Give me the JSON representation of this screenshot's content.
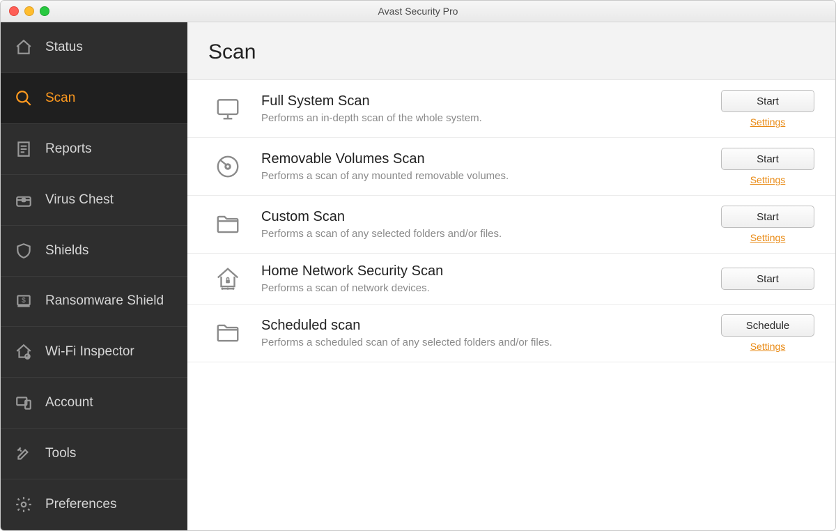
{
  "window_title": "Avast Security Pro",
  "sidebar": {
    "items": [
      {
        "id": "status",
        "label": "Status",
        "active": false
      },
      {
        "id": "scan",
        "label": "Scan",
        "active": true
      },
      {
        "id": "reports",
        "label": "Reports",
        "active": false
      },
      {
        "id": "virus-chest",
        "label": "Virus Chest",
        "active": false
      },
      {
        "id": "shields",
        "label": "Shields",
        "active": false
      },
      {
        "id": "ransomware-shield",
        "label": "Ransomware Shield",
        "active": false
      },
      {
        "id": "wifi-inspector",
        "label": "Wi-Fi Inspector",
        "active": false
      },
      {
        "id": "account",
        "label": "Account",
        "active": false
      },
      {
        "id": "tools",
        "label": "Tools",
        "active": false
      },
      {
        "id": "preferences",
        "label": "Preferences",
        "active": false
      }
    ]
  },
  "page": {
    "title": "Scan",
    "scans": [
      {
        "id": "full-system",
        "title": "Full System Scan",
        "desc": "Performs an in-depth scan of the whole system.",
        "button": "Start",
        "settings_label": "Settings",
        "show_settings": true
      },
      {
        "id": "removable",
        "title": "Removable Volumes Scan",
        "desc": "Performs a scan of any mounted removable volumes.",
        "button": "Start",
        "settings_label": "Settings",
        "show_settings": true
      },
      {
        "id": "custom",
        "title": "Custom Scan",
        "desc": "Performs a scan of any selected folders and/or files.",
        "button": "Start",
        "settings_label": "Settings",
        "show_settings": true
      },
      {
        "id": "network",
        "title": "Home Network Security Scan",
        "desc": "Performs a scan of network devices.",
        "button": "Start",
        "settings_label": "Settings",
        "show_settings": false
      },
      {
        "id": "scheduled",
        "title": "Scheduled scan",
        "desc": "Performs a scheduled scan of any selected folders and/or files.",
        "button": "Schedule",
        "settings_label": "Settings",
        "show_settings": true
      }
    ]
  },
  "colors": {
    "accent": "#ff9a1f",
    "link": "#e98a14",
    "sidebar_bg": "#2e2e2e"
  }
}
